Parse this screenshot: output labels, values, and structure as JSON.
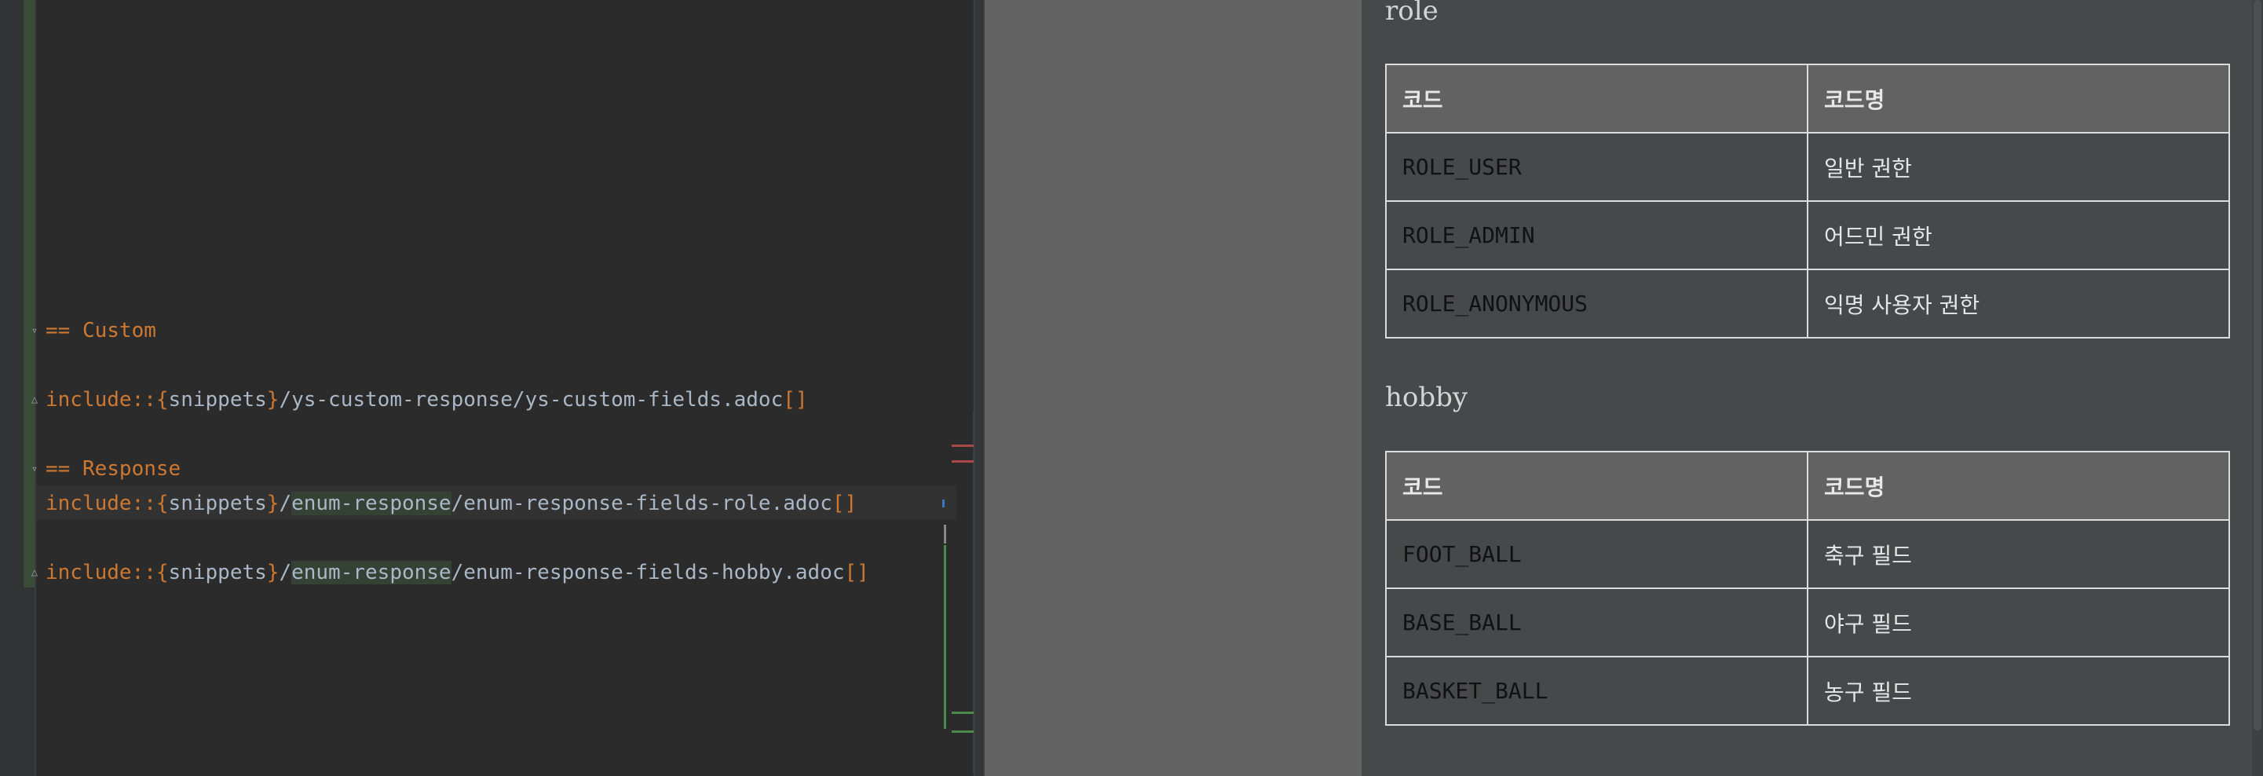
{
  "editor": {
    "lines": [
      {
        "parts": [
          {
            "t": "== Custom",
            "c": "kw"
          }
        ]
      },
      {
        "parts": [
          {
            "t": "include::{",
            "c": "kw"
          },
          {
            "t": "snippets",
            "c": "pl"
          },
          {
            "t": "}",
            "c": "kw"
          },
          {
            "t": "/ys-custom-response/ys-custom-fields.adoc",
            "c": "pl"
          },
          {
            "t": "[]",
            "c": "kw"
          }
        ]
      },
      {
        "parts": [
          {
            "t": "== Response",
            "c": "kw"
          }
        ]
      },
      {
        "parts": [
          {
            "t": "include::{",
            "c": "kw"
          },
          {
            "t": "snippets",
            "c": "pl"
          },
          {
            "t": "}",
            "c": "kw"
          },
          {
            "t": "/",
            "c": "pl"
          },
          {
            "t": "enum-response",
            "c": "hl"
          },
          {
            "t": "/enum-response-fields-role.adoc",
            "c": "pl"
          },
          {
            "t": "[]",
            "c": "kw"
          }
        ]
      },
      {
        "parts": [
          {
            "t": "include::{",
            "c": "kw"
          },
          {
            "t": "snippets",
            "c": "pl"
          },
          {
            "t": "}",
            "c": "kw"
          },
          {
            "t": "/",
            "c": "pl"
          },
          {
            "t": "enum-response",
            "c": "hl"
          },
          {
            "t": "/enum-response-fields-hobby.adoc",
            "c": "pl"
          },
          {
            "t": "[]",
            "c": "kw"
          }
        ]
      }
    ]
  },
  "preview": {
    "role": {
      "title": "role",
      "headers": [
        "코드",
        "코드명"
      ],
      "rows": [
        [
          "ROLE_USER",
          "일반 권한"
        ],
        [
          "ROLE_ADMIN",
          "어드민 권한"
        ],
        [
          "ROLE_ANONYMOUS",
          "익명 사용자 권한"
        ]
      ]
    },
    "hobby": {
      "title": "hobby",
      "headers": [
        "코드",
        "코드명"
      ],
      "rows": [
        [
          "FOOT_BALL",
          "축구 필드"
        ],
        [
          "BASE_BALL",
          "야구 필드"
        ],
        [
          "BASKET_BALL",
          "농구 필드"
        ]
      ]
    }
  },
  "colors": {
    "keyword": "#cc7832",
    "plain": "#a9b7c6",
    "highlight_bg": "#344134",
    "editor_bg": "#2b2b2b",
    "preview_bg": "#45494a",
    "table_header_bg": "#626262"
  },
  "icons": {
    "fold_open": "fold-collapse-icon",
    "fold_end": "fold-end-icon"
  }
}
